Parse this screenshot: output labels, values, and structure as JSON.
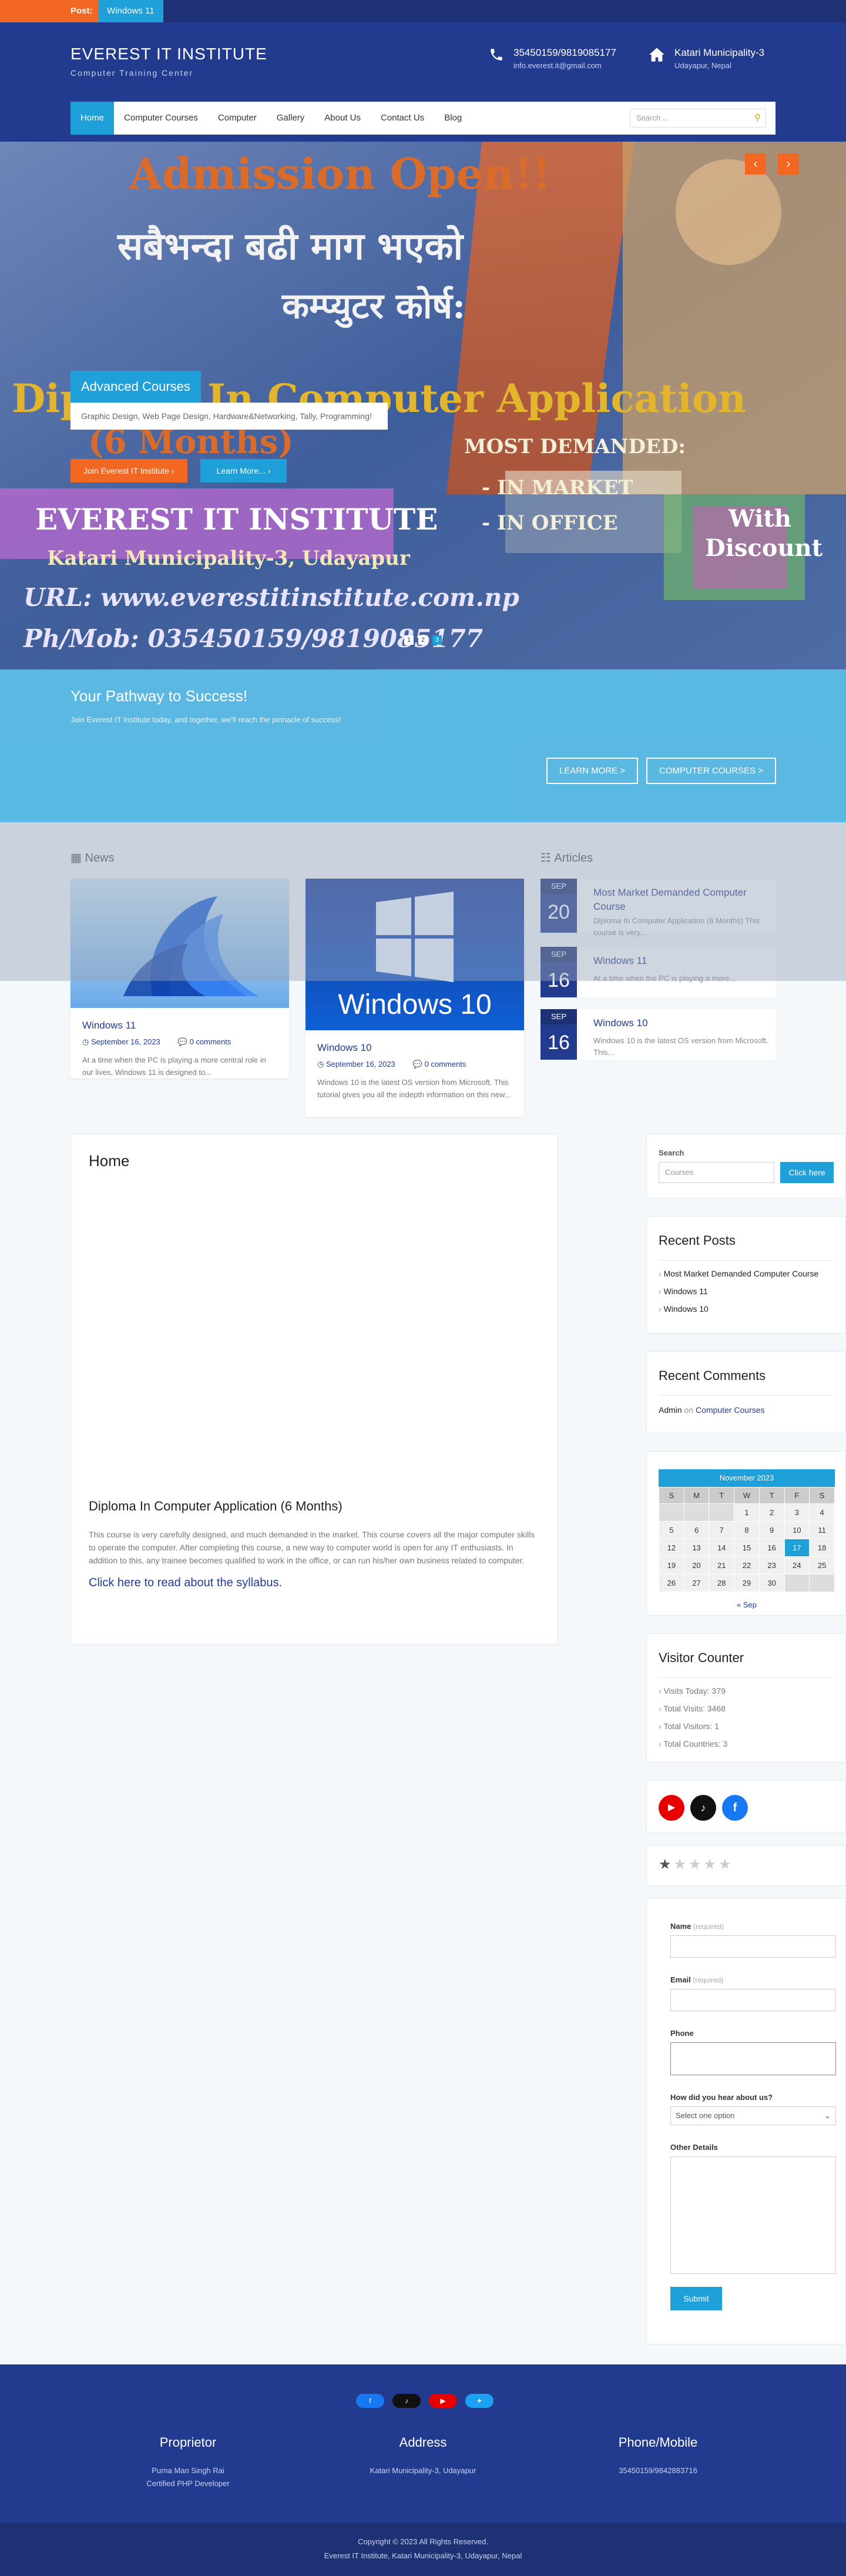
{
  "ticker": {
    "label": "Post:",
    "text": "Windows 11"
  },
  "header": {
    "title": "EVEREST IT INSTITUTE",
    "tagline": "Computer Training Center",
    "phone": "35450159/9819085177",
    "email": "info.everest.it@gmail.com",
    "address_main": "Katari Municipality-3",
    "address_sub": "Udayapur, Nepal"
  },
  "nav": {
    "items": [
      "Home",
      "Computer Courses",
      "Computer",
      "Gallery",
      "About Us",
      "Contact Us",
      "Blog"
    ],
    "search_placeholder": "Search ..."
  },
  "hero": {
    "banner_line1": "Admission Open!!",
    "banner_line2": "सबैभन्दा बढी माग भएको",
    "banner_line3": "कम्प्युटर कोर्ष:",
    "banner_line4": "Diploma In Computer Application",
    "banner_months": "(6 Months)",
    "banner_demand": "MOST DEMANDED:",
    "banner_market": "- IN MARKET",
    "banner_office": "- IN OFFICE",
    "banner_discount1": "With",
    "banner_discount2": "Discount",
    "banner_institute": "EVEREST IT INSTITUTE",
    "banner_municipality": "Katari Municipality-3, Udayapur",
    "banner_url": "URL: www.everestitinstitute.com.np",
    "banner_phone": "Ph/Mob: 035450159/9819085177",
    "caption_title": "Advanced Courses",
    "caption_text": "Graphic Design, Web Page Design, Hardware&Networking, Tally, Programming!",
    "btn_join": "Join Everest IT Institute  ›",
    "btn_more": "Learn More...  ›",
    "dots": [
      "1",
      "2",
      "3"
    ],
    "arrow_prev": "‹",
    "arrow_next": "›"
  },
  "pathway": {
    "title": "Your Pathway to Success!",
    "text": "Join Everest IT Institute today, and together, we'll reach the pinnacle of success!",
    "btn_learn": "LEARN MORE >",
    "btn_courses": "COMPUTER COURSES >"
  },
  "news": {
    "heading": "News",
    "cards": [
      {
        "title": "Windows 11",
        "date": "September 16, 2023",
        "comments": "0 comments",
        "excerpt": "At a time when the PC is playing a more central role in our lives, Windows 11 is designed to..."
      },
      {
        "title": "Windows 10",
        "date": "September 16, 2023",
        "comments": "0 comments",
        "excerpt": "Windows 10 is the latest OS version from Microsoft. This tutorial gives you all the indepth information on this new...",
        "image_text": "Windows 10"
      }
    ]
  },
  "articles": {
    "heading": "Articles",
    "items": [
      {
        "month": "SEP",
        "day": "20",
        "title": "Most Market Demanded Computer Course",
        "excerpt": "Diploma In Computer Application (6 Months) This course is very..."
      },
      {
        "month": "SEP",
        "day": "16",
        "title": "Windows 11",
        "excerpt": "At a time when the PC is playing a more..."
      },
      {
        "month": "SEP",
        "day": "16",
        "title": "Windows 10",
        "excerpt": "Windows 10 is the latest OS version from Microsoft. This..."
      }
    ]
  },
  "home": {
    "title": "Home",
    "course_title": "Diploma In Computer Application (6 Months)",
    "course_text": "This course is very carefully designed, and much demanded in the market. This course covers all the major computer skills to operate the computer. After completing this course, a new way to computer world is open for any IT enthusiasts. In addition to this, any trainee becomes qualified to work in the office, or can run his/her own business related to computer.",
    "syllabus_link": "Click here to read about the syllabus."
  },
  "sidebar": {
    "search_label": "Search",
    "search_placeholder": "Courses",
    "search_button": "Click here",
    "recent_posts_title": "Recent Posts",
    "recent_posts": [
      "Most Market Demanded Computer Course",
      "Windows 11",
      "Windows 10"
    ],
    "recent_comments_title": "Recent Comments",
    "comment_author": "Admin",
    "comment_on": "on",
    "comment_post": "Computer Courses",
    "calendar": {
      "caption": "November 2023",
      "weekdays": [
        "S",
        "M",
        "T",
        "W",
        "T",
        "F",
        "S"
      ],
      "rows": [
        [
          "",
          "",
          "",
          "1",
          "2",
          "3",
          "4"
        ],
        [
          "5",
          "6",
          "7",
          "8",
          "9",
          "10",
          "11"
        ],
        [
          "12",
          "13",
          "14",
          "15",
          "16",
          "17",
          "18"
        ],
        [
          "19",
          "20",
          "21",
          "22",
          "23",
          "24",
          "25"
        ],
        [
          "26",
          "27",
          "28",
          "29",
          "30",
          "",
          ""
        ]
      ],
      "today": "17",
      "prev_link": "« Sep"
    },
    "visitor_title": "Visitor Counter",
    "visitor_items": [
      "Visits Today: 379",
      "Total Visits: 3468",
      "Total Visitors: 1",
      "Total Countries: 3"
    ],
    "rating": {
      "value": 1,
      "max": 5
    },
    "form": {
      "name_label": "Name",
      "email_label": "Email",
      "required": "(required)",
      "phone_label": "Phone",
      "hear_label": "How did you hear about us?",
      "hear_placeholder": "Select one option",
      "details_label": "Other Details",
      "submit": "Submit"
    }
  },
  "footer": {
    "col1_title": "Proprietor",
    "col1_line1": "Purna Man Singh Rai",
    "col1_line2": "Certified PHP Developer",
    "col2_title": "Address",
    "col2_line1": "Katari Municipality-3, Udayapur",
    "col3_title": "Phone/Mobile",
    "col3_line1": "35450159/9842883716",
    "copyright": "Copyright © 2023 All Rights Reserved.",
    "address_line": "Everest IT Institute, Katari Municipality-3, Udayapur, Nepal"
  },
  "colors": {
    "primary": "#233b8f",
    "accent": "#1fa0d8",
    "orange": "#f26722"
  }
}
